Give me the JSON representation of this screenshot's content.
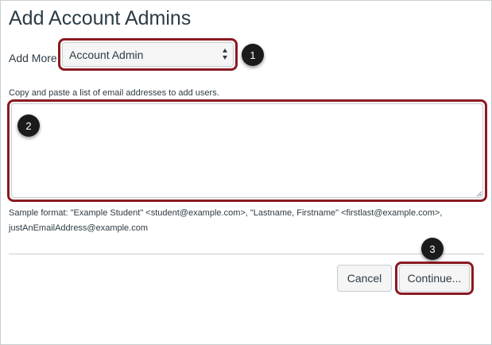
{
  "dialog": {
    "title": "Add Account Admins"
  },
  "add_more": {
    "label": "Add More",
    "selected": "Account Admin"
  },
  "emails": {
    "instructions": "Copy and paste a list of email addresses to add users.",
    "value": "",
    "sample_format": "Sample format: \"Example Student\" <student@example.com>, \"Lastname, Firstname\" <firstlast@example.com>, justAnEmailAddress@example.com"
  },
  "buttons": {
    "cancel_label": "Cancel",
    "continue_label": "Continue..."
  },
  "callouts": [
    "1",
    "2",
    "3"
  ],
  "colors": {
    "highlight": "#8b1a22",
    "callout_bg": "#1b1b1b",
    "text": "#2d3b45",
    "border": "#c7cdd1",
    "button_bg": "#f5f5f5"
  },
  "icons": {
    "select_arrows": "up-down-arrows-icon",
    "resize_grip": "resize-grip-icon"
  }
}
